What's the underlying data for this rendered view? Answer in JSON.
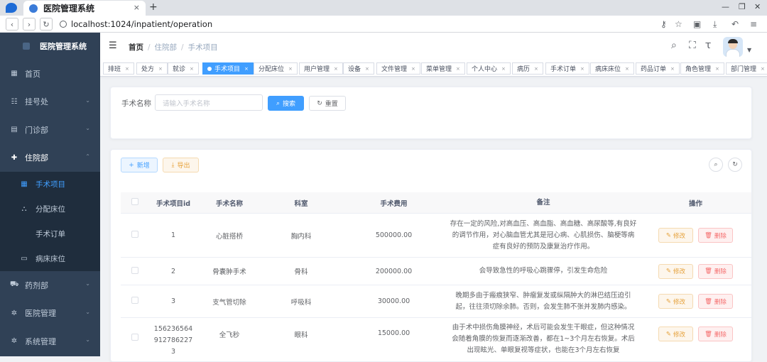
{
  "browser": {
    "tab_title": "医院管理系统",
    "tab_close": "×",
    "new_tab": "+",
    "url": "localhost:1024/inpatient/operation",
    "back": "‹",
    "forward": "›",
    "reload": "↻"
  },
  "sidebar": {
    "brand": "医院管理系统",
    "items": [
      {
        "label": "首页",
        "icon": "▦"
      },
      {
        "label": "挂号处",
        "icon": "☷",
        "arrow": "⌄"
      },
      {
        "label": "门诊部",
        "icon": "▤",
        "arrow": "⌄"
      },
      {
        "label": "住院部",
        "icon": "✚",
        "arrow": "⌃"
      },
      {
        "label": "药剂部",
        "icon": "⛟",
        "arrow": "⌄"
      },
      {
        "label": "医院管理",
        "icon": "✲",
        "arrow": "⌄"
      },
      {
        "label": "系统管理",
        "icon": "✲",
        "arrow": "⌄"
      }
    ],
    "subitems": [
      {
        "label": "手术项目",
        "icon": "▦"
      },
      {
        "label": "分配床位",
        "icon": "⛬"
      },
      {
        "label": "手术订单",
        "icon": ""
      },
      {
        "label": "病床床位",
        "icon": "▭"
      }
    ]
  },
  "header": {
    "menu_icon": "☰",
    "breadcrumb": [
      "首页",
      "住院部",
      "手术项目"
    ],
    "sep": "/"
  },
  "tags": [
    {
      "label": "排班"
    },
    {
      "label": "处方"
    },
    {
      "label": "就诊"
    },
    {
      "label": "手术项目",
      "active": true
    },
    {
      "label": "分配床位"
    },
    {
      "label": "用户管理"
    },
    {
      "label": "设备"
    },
    {
      "label": "文件管理"
    },
    {
      "label": "菜单管理"
    },
    {
      "label": "个人中心"
    },
    {
      "label": "病历"
    },
    {
      "label": "手术订单"
    },
    {
      "label": "病床床位"
    },
    {
      "label": "药品订单"
    },
    {
      "label": "角色管理"
    },
    {
      "label": "部门管理"
    }
  ],
  "tag_close": "×",
  "search": {
    "label": "手术名称",
    "placeholder": "请输入手术名称",
    "search_btn": "搜索",
    "reset_btn": "重置"
  },
  "toolbar": {
    "add_btn": "新增",
    "export_btn": "导出"
  },
  "table": {
    "columns": [
      "",
      "手术项目id",
      "手术名称",
      "科室",
      "手术费用",
      "备注",
      "操作"
    ],
    "edit_label": "修改",
    "delete_label": "删除",
    "rows": [
      {
        "id": "1",
        "name": "心脏搭桥",
        "dept": "胸内科",
        "fee": "500000.00",
        "note": "存在一定的风险,对高血压、高血脂、高血糖、高尿酸等,有良好的调节作用，对心脑血管尤其是冠心病、心肌损伤、脑梗等病症有良好的预防及康复治疗作用。"
      },
      {
        "id": "2",
        "name": "骨囊肿手术",
        "dept": "骨科",
        "fee": "200000.00",
        "note": "会导致急性的呼吸心跳骤停，引发生命危险"
      },
      {
        "id": "3",
        "name": "支气管切除",
        "dept": "呼吸科",
        "fee": "30000.00",
        "note": "晚期多由于瘢痕狭窄、肿瘤复发或纵隔肿大的淋巴结压迫引起，往往须切除余肺。否则，会发生肺不张并发肺内感染。"
      },
      {
        "id": "1562365649127862273",
        "name": "全飞秒",
        "dept": "眼科",
        "fee": "15000.00",
        "note": "由于术中损伤角膜神经，术后可能会发生干眼症，但这种情况会随着角膜的恢复而逐渐改善，都在1~3个月左右恢复。术后出现眩光、单眼复视等症状，也能在3个月左右恢复"
      }
    ]
  }
}
